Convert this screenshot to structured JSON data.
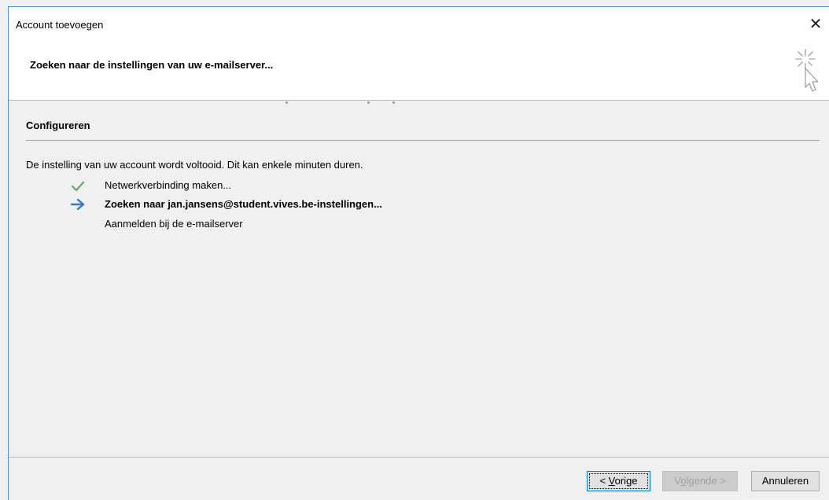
{
  "window": {
    "title": "Account toevoegen",
    "close_glyph": "✕"
  },
  "header": {
    "title": "Zoeken naar de instellingen van uw e-mailserver...",
    "icon": "sparkle-cursor-icon"
  },
  "section": {
    "title": "Configureren",
    "intro": "De instelling van uw account wordt voltooid. Dit kan enkele minuten duren."
  },
  "steps": [
    {
      "label": "Netwerkverbinding maken...",
      "status": "done",
      "icon": "checkmark-icon"
    },
    {
      "label": "Zoeken naar jan.jansens@student.vives.be-instellingen...",
      "status": "active",
      "icon": "arrow-right-icon"
    },
    {
      "label": "Aanmelden bij de e-mailserver",
      "status": "pending",
      "icon": ""
    }
  ],
  "buttons": {
    "prev_prefix": "< ",
    "prev_mnemonic": "V",
    "prev_rest": "orige",
    "next_prefix": "V",
    "next_mnemonic": "o",
    "next_rest": "lgende >",
    "cancel": "Annuleren"
  },
  "colors": {
    "check": "#5fa86f",
    "arrow": "#3a78c0",
    "accent_border": "#0078d7"
  }
}
